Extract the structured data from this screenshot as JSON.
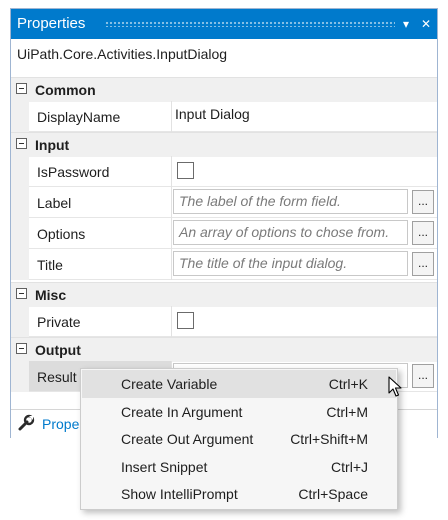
{
  "panel": {
    "title": "Properties",
    "pin_glyph": "▾",
    "close_glyph": "✕",
    "type_name": "UiPath.Core.Activities.InputDialog"
  },
  "categories": {
    "common": {
      "label": "Common",
      "props": [
        {
          "name": "DisplayName",
          "value": "Input Dialog"
        }
      ]
    },
    "input": {
      "label": "Input",
      "props": [
        {
          "name": "IsPassword"
        },
        {
          "name": "Label",
          "placeholder": "The label of the form field."
        },
        {
          "name": "Options",
          "placeholder": "An array of options to chose from."
        },
        {
          "name": "Title",
          "placeholder": "The title of the input dialog."
        }
      ]
    },
    "misc": {
      "label": "Misc",
      "props": [
        {
          "name": "Private"
        }
      ]
    },
    "output": {
      "label": "Output",
      "props": [
        {
          "name": "Result",
          "value": ""
        }
      ]
    }
  },
  "ellipsis_label": "...",
  "footer": {
    "tab_label": "Prope"
  },
  "context_menu": {
    "items": [
      {
        "label": "Create Variable",
        "shortcut": "Ctrl+K"
      },
      {
        "label": "Create In Argument",
        "shortcut": "Ctrl+M"
      },
      {
        "label": "Create Out Argument",
        "shortcut": "Ctrl+Shift+M"
      },
      {
        "label": "Insert Snippet",
        "shortcut": "Ctrl+J"
      },
      {
        "label": "Show IntelliPrompt",
        "shortcut": "Ctrl+Space"
      }
    ]
  },
  "colors": {
    "accent": "#007acc",
    "category_bg": "#f0f0f0",
    "menu_highlight": "#e1e1e1"
  }
}
